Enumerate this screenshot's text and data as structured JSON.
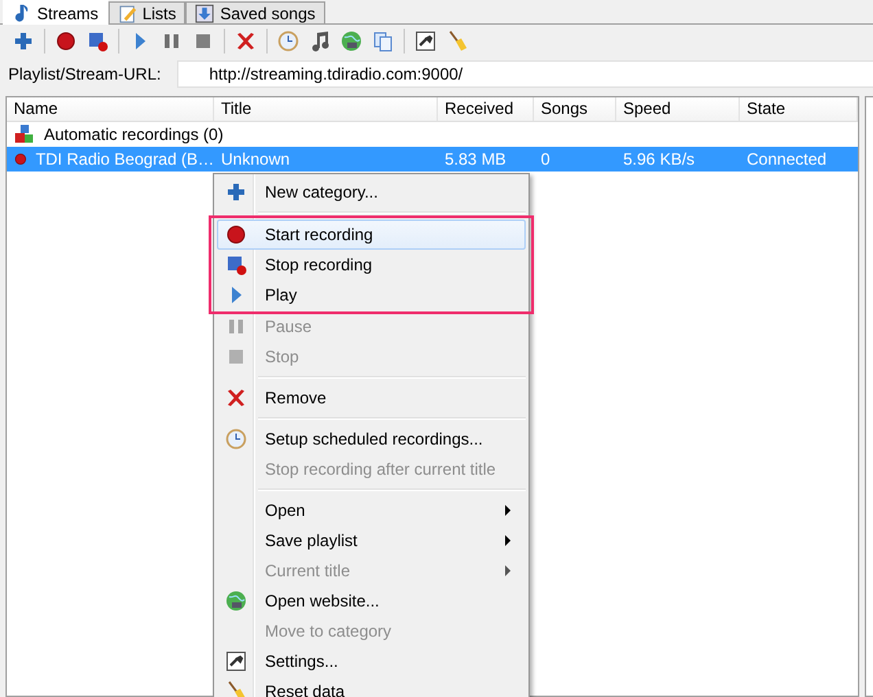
{
  "tabs": [
    {
      "label": "Streams",
      "selected": true
    },
    {
      "label": "Lists",
      "selected": false
    },
    {
      "label": "Saved songs",
      "selected": false
    }
  ],
  "url": {
    "label": "Playlist/Stream-URL:",
    "value": "http://streaming.tdiradio.com:9000/"
  },
  "table": {
    "columns": [
      "Name",
      "Title",
      "Received",
      "Songs",
      "Speed",
      "State"
    ],
    "rows": [
      {
        "kind": "category",
        "name": "Automatic recordings (0)",
        "selected": false
      },
      {
        "kind": "stream",
        "name": "TDI Radio Beograd (B…",
        "title": "Unknown",
        "received": "5.83 MB",
        "songs": "0",
        "speed": "5.96 KB/s",
        "state": "Connected",
        "selected": true
      }
    ]
  },
  "context_menu": {
    "items": [
      {
        "kind": "item",
        "label": "New category...",
        "disabled": false,
        "hovered": false,
        "boxed": false,
        "submenu": false
      },
      {
        "kind": "separator"
      },
      {
        "kind": "item",
        "label": "Start recording",
        "disabled": false,
        "hovered": true,
        "boxed": true,
        "submenu": false
      },
      {
        "kind": "item",
        "label": "Stop recording",
        "disabled": false,
        "hovered": false,
        "boxed": true,
        "submenu": false
      },
      {
        "kind": "item",
        "label": "Play",
        "disabled": false,
        "hovered": false,
        "boxed": true,
        "submenu": false
      },
      {
        "kind": "item",
        "label": "Pause",
        "disabled": true,
        "hovered": false,
        "boxed": false,
        "submenu": false
      },
      {
        "kind": "item",
        "label": "Stop",
        "disabled": true,
        "hovered": false,
        "boxed": false,
        "submenu": false
      },
      {
        "kind": "separator"
      },
      {
        "kind": "item",
        "label": "Remove",
        "disabled": false,
        "hovered": false,
        "boxed": false,
        "submenu": false
      },
      {
        "kind": "separator"
      },
      {
        "kind": "item",
        "label": "Setup scheduled recordings...",
        "disabled": false,
        "hovered": false,
        "boxed": false,
        "submenu": false
      },
      {
        "kind": "item",
        "label": "Stop recording after current title",
        "disabled": true,
        "hovered": false,
        "boxed": false,
        "submenu": false
      },
      {
        "kind": "separator"
      },
      {
        "kind": "item",
        "label": "Open",
        "disabled": false,
        "hovered": false,
        "boxed": false,
        "submenu": true
      },
      {
        "kind": "item",
        "label": "Save playlist",
        "disabled": false,
        "hovered": false,
        "boxed": false,
        "submenu": true
      },
      {
        "kind": "item",
        "label": "Current title",
        "disabled": true,
        "hovered": false,
        "boxed": false,
        "submenu": true
      },
      {
        "kind": "item",
        "label": "Open website...",
        "disabled": false,
        "hovered": false,
        "boxed": false,
        "submenu": false
      },
      {
        "kind": "item",
        "label": "Move to category",
        "disabled": true,
        "hovered": false,
        "boxed": false,
        "submenu": false
      },
      {
        "kind": "item",
        "label": "Settings...",
        "disabled": false,
        "hovered": false,
        "boxed": false,
        "submenu": false
      },
      {
        "kind": "item",
        "label": "Reset data",
        "disabled": false,
        "hovered": false,
        "boxed": false,
        "submenu": false
      }
    ]
  }
}
